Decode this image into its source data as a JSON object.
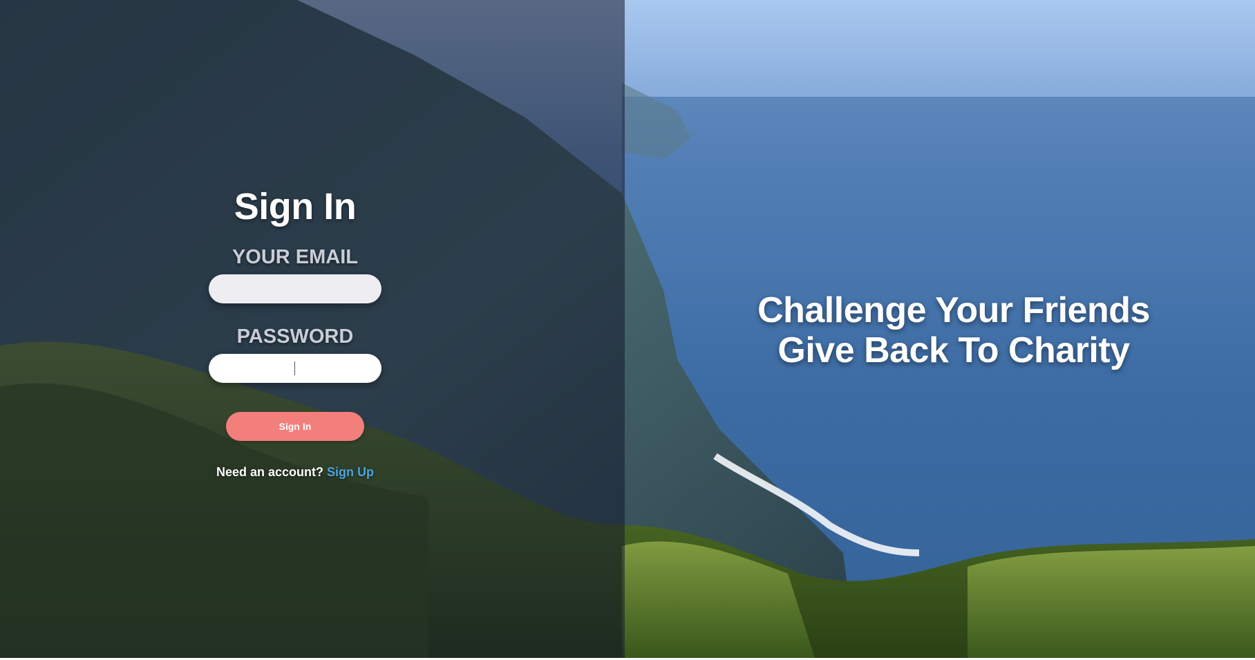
{
  "signin": {
    "title": "Sign In",
    "email_label": "YOUR EMAIL",
    "email_value": "",
    "password_label": "PASSWORD",
    "password_value": "",
    "button_label": "Sign In",
    "account_prompt": "Need an account?",
    "signup_link": "Sign Up"
  },
  "hero": {
    "line1": "Challenge Your Friends",
    "line2": "Give Back To Charity"
  },
  "colors": {
    "button": "#f27f7b",
    "link": "#4aa3df",
    "overlay": "#141a2c"
  }
}
